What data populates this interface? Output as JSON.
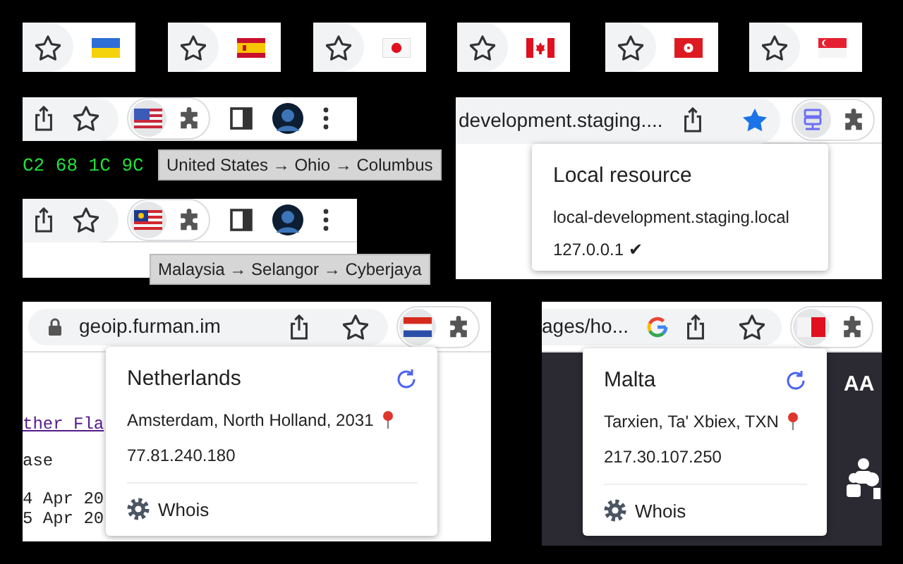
{
  "flag_tiles": [
    {
      "kind": "ua",
      "bookmarked": false
    },
    {
      "kind": "es",
      "bookmarked": false
    },
    {
      "kind": "jp",
      "bookmarked": false
    },
    {
      "kind": "ca",
      "bookmarked": false
    },
    {
      "kind": "hk",
      "bookmarked": false
    },
    {
      "kind": "sg",
      "bookmarked": false
    }
  ],
  "tooltip_tiles": [
    {
      "flag": {
        "kind": "us"
      },
      "bookmarked": false,
      "tooltip": "United States → Ohio → Columbus",
      "terminal_text": "C2 68 1C 9C"
    },
    {
      "flag": {
        "kind": "my"
      },
      "bookmarked": false,
      "tooltip": "Malaysia → Selangor → Cyberjaya"
    }
  ],
  "local_tile": {
    "address": "development.staging....",
    "bookmarked": true,
    "popup": {
      "title": "Local resource",
      "host": "local-development.staging.local",
      "ip": "127.0.0.1 ✔"
    }
  },
  "geo_tiles": [
    {
      "address": "geoip.furman.im",
      "secure": true,
      "google": false,
      "bookmarked": false,
      "flag": {
        "kind": "nl"
      },
      "page": {
        "kind": "light",
        "lines": [
          {
            "kind": "link",
            "text": "ther Fla"
          },
          {
            "kind": "text",
            "text": "ase"
          },
          {
            "kind": "text",
            "text": "4 Apr 20"
          },
          {
            "kind": "text",
            "text": "5 Apr 20"
          }
        ]
      },
      "popup": {
        "title": "Netherlands",
        "location": "Amsterdam, North Holland, 2031",
        "ip": "77.81.240.180",
        "action": "Whois"
      }
    },
    {
      "address": "ages/ho...",
      "secure": false,
      "google": true,
      "bookmarked": false,
      "flag": {
        "kind": "mt"
      },
      "page": {
        "kind": "dark",
        "lines": [
          {
            "kind": "heading",
            "text": "AA"
          }
        ]
      },
      "popup": {
        "title": "Malta",
        "location": "Tarxien, Ta' Xbiex, TXN",
        "ip": "217.30.107.250",
        "action": "Whois"
      }
    }
  ]
}
